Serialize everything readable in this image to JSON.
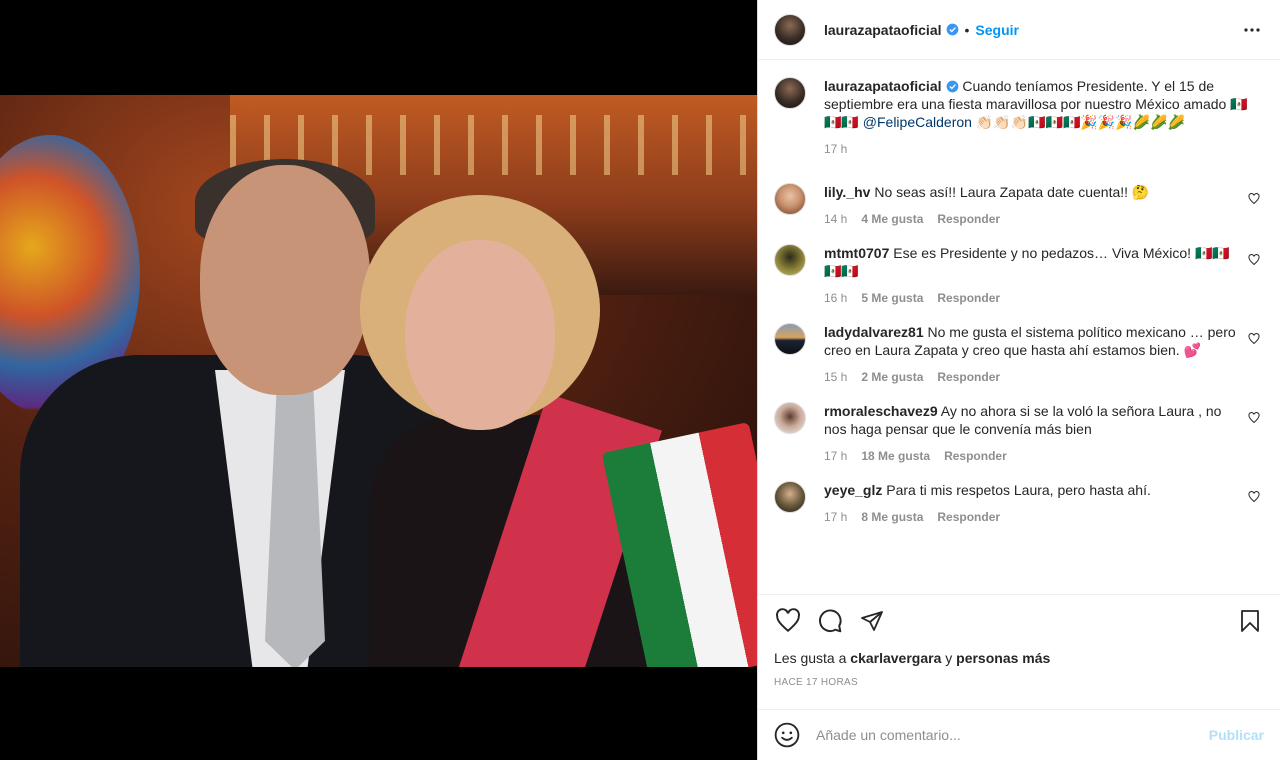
{
  "post": {
    "image_alt": "Foto de Laura Zapata junto a Felipe Calderón",
    "author": "laurazapataoficial",
    "follow_label": "Seguir",
    "separator": "•",
    "caption": {
      "text": "Cuando teníamos Presidente. Y el 15 de septiembre era una fiesta maravillosa por nuestro México amado",
      "flags_before": "🇲🇽🇲🇽🇲🇽",
      "mention": "@FelipeCalderon",
      "emojis_after": "👏🏻👏🏻👏🏻🇲🇽🇲🇽🇲🇽🎉🎉🎉🌽🌽🌽",
      "time": "17 h"
    }
  },
  "comments": [
    {
      "user": "lily._hv",
      "text": "No seas así!! Laura Zapata date cuenta!! 🤔",
      "time": "14 h",
      "likes": "4 Me gusta",
      "reply": "Responder",
      "avatar": "#c9926e"
    },
    {
      "user": "mtmt0707",
      "text": "Ese es Presidente y no pedazos… Viva México! 🇲🇽🇲🇽🇲🇽🇲🇽",
      "time": "16 h",
      "likes": "5 Me gusta",
      "reply": "Responder",
      "avatar": "#b2a24a"
    },
    {
      "user": "ladydalvarez81",
      "text": "No me gusta el sistema político mexicano … pero creo en Laura Zapata y creo que hasta ahí estamos bien. 💕",
      "time": "15 h",
      "likes": "2 Me gusta",
      "reply": "Responder",
      "avatar": "#2d3747"
    },
    {
      "user": "rmoraleschavez9",
      "text": "Ay no ahora si se la voló la señora Laura , no nos haga pensar que le convenía más bien",
      "time": "17 h",
      "likes": "18 Me gusta",
      "reply": "Responder",
      "avatar": "#d7c3b6"
    },
    {
      "user": "yeye_glz",
      "text": "Para ti mis respetos Laura, pero hasta ahí.",
      "time": "17 h",
      "likes": "8 Me gusta",
      "reply": "Responder",
      "avatar": "#6b5a3c"
    }
  ],
  "likes_line": {
    "prefix": "Les gusta a",
    "user": "ckarlavergara",
    "conj": "y",
    "rest": "personas más"
  },
  "timestamp": "Hace 17 horas",
  "composer": {
    "placeholder": "Añade un comentario...",
    "post_label": "Publicar"
  },
  "colors": {
    "accent": "#0095f6",
    "verified": "#3897f0",
    "post_disabled": "#b2dffc"
  }
}
